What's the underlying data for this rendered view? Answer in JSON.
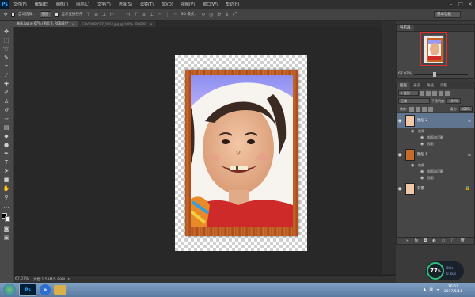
{
  "app": {
    "logo_text": "Ps"
  },
  "menu": [
    "文件(F)",
    "编辑(E)",
    "图像(I)",
    "图层(L)",
    "文字(Y)",
    "选择(S)",
    "滤镜(T)",
    "3D(D)",
    "视图(V)",
    "窗口(W)",
    "帮助(H)"
  ],
  "window_controls": {
    "minimize": "–",
    "maximize": "□",
    "close": "✕"
  },
  "options_bar": {
    "auto_select_label": "自动选择：",
    "auto_select_value": "图层",
    "show_transform_label": "显示变换控件",
    "mode_3d_label": "3D 模式：",
    "workspace": "基本功能"
  },
  "tabs": [
    {
      "label": "肺画.jpg @ 67% (图层 2, RGB/8) *",
      "close": "×",
      "active": true
    },
    {
      "label": "52b0OOPIC87_1024.jpg @ 100% (RGB/8)",
      "close": "×",
      "active": false
    }
  ],
  "tools": [
    "move-tool",
    "marquee-tool",
    "lasso-tool",
    "quick-select-tool",
    "crop-tool",
    "eyedropper-tool",
    "healing-tool",
    "brush-tool",
    "stamp-tool",
    "history-brush-tool",
    "eraser-tool",
    "gradient-tool",
    "blur-tool",
    "dodge-tool",
    "pen-tool",
    "type-tool",
    "path-select-tool",
    "shape-tool",
    "hand-tool",
    "zoom-tool"
  ],
  "status": {
    "zoom": "67.07%",
    "doc_info": "文档:1.53M/5.89M",
    "arrow": "▸"
  },
  "navigator": {
    "tab_label": "导航器",
    "zoom": "67.07%"
  },
  "layers": {
    "tabs": [
      "图层",
      "通道",
      "路径",
      "调整"
    ],
    "filter_label": "ρ 类型",
    "blend_mode": "正常",
    "opacity_label": "不透明度:",
    "opacity_value": "100%",
    "lock_label": "锁定:",
    "fill_label": "填充:",
    "fill_value": "100%",
    "items": [
      {
        "name": "图层 2",
        "fx": "fx",
        "selected": true,
        "effects_label": "效果",
        "effects": [
          "斜面和浮雕",
          "投影"
        ]
      },
      {
        "name": "图层 1",
        "fx": "fx",
        "selected": false,
        "effects_label": "效果",
        "effects": [
          "斜面和浮雕",
          "投影"
        ]
      },
      {
        "name": "背景",
        "fx": "",
        "selected": false,
        "lock": true
      }
    ],
    "bottom_icons": [
      "link-icon",
      "fx-icon",
      "mask-icon",
      "adjustment-icon",
      "folder-icon",
      "new-layer-icon",
      "trash-icon"
    ]
  },
  "net_widget": {
    "percent": "77",
    "percent_sign": "%",
    "up": "0k/s",
    "down": "0.1k/s"
  },
  "taskbar": {
    "ps_label": "Ps",
    "ie_label": "e",
    "time": "16:51",
    "date": "2017/5/11"
  },
  "colors": {
    "selected_layer": "#5f7590",
    "frame_wood": "#c86a2a"
  }
}
